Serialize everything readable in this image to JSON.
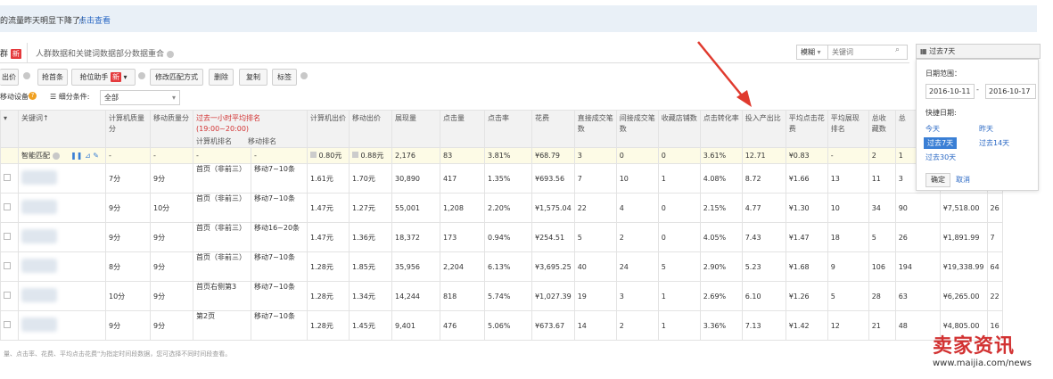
{
  "notice": {
    "text": "的流量昨天明显下降了！",
    "link": "点击查看"
  },
  "tabs": {
    "first_label": "群",
    "new_badge": "新",
    "second_label": "人群数据和关键词数据部分数据重合"
  },
  "search": {
    "mode": "模糊",
    "placeholder": "关键词"
  },
  "date_button": {
    "label": "过去7天"
  },
  "toolbar": {
    "buttons": [
      "出价",
      "抢首条",
      "抢位助手",
      "修改匹配方式",
      "删除",
      "复制",
      "标签"
    ],
    "new_badge": "新",
    "device": "移动设备",
    "filter_label": "细分条件:",
    "filter_value": "全部"
  },
  "table": {
    "headers": [
      "",
      "关键词↑",
      "计算机质量分",
      "移动质量分",
      "过去一小时平均排名(19:00~20:00)",
      "计算机出价",
      "移动出价",
      "展现量",
      "点击量",
      "点击率",
      "花费",
      "直接成交笔数",
      "间接成交笔数",
      "收藏店铺数",
      "点击转化率",
      "投入产出比",
      "平均点击花费",
      "平均展现排名",
      "总收藏数",
      "总",
      ""
    ],
    "subheaders": [
      "计算机排名",
      "移动排名"
    ],
    "summary": {
      "keyword": "智能匹配",
      "cells": [
        "-",
        "-",
        "-",
        "-",
        "0.80元",
        "0.88元",
        "2,176",
        "83",
        "3.81%",
        "¥68.79",
        "3",
        "0",
        "0",
        "3.61%",
        "12.71",
        "¥0.83",
        "-",
        "2",
        "1",
        "",
        ""
      ]
    },
    "rows": [
      {
        "pc_q": "7分",
        "m_q": "9分",
        "pc_rank": "首页（非前三）",
        "m_rank": "移动7~10条",
        "pc_bid": "1.61元",
        "m_bid": "1.70元",
        "impr": "30,890",
        "clicks": "417",
        "ctr": "1.35%",
        "cost": "¥693.56",
        "direct": "7",
        "indirect": "10",
        "fav_shop": "1",
        "cvr": "4.08%",
        "roi": "8.72",
        "cpc": "¥1.66",
        "avg_rank": "13",
        "fav_total": "11",
        "c1": "3",
        "c2": "",
        "c3": ""
      },
      {
        "pc_q": "9分",
        "m_q": "10分",
        "pc_rank": "首页（非前三）",
        "m_rank": "移动7~10条",
        "pc_bid": "1.47元",
        "m_bid": "1.27元",
        "impr": "55,001",
        "clicks": "1,208",
        "ctr": "2.20%",
        "cost": "¥1,575.04",
        "direct": "22",
        "indirect": "4",
        "fav_shop": "0",
        "cvr": "2.15%",
        "roi": "4.77",
        "cpc": "¥1.30",
        "avg_rank": "10",
        "fav_total": "34",
        "c1": "90",
        "c2": "¥7,518.00",
        "c3": "26"
      },
      {
        "pc_q": "9分",
        "m_q": "9分",
        "pc_rank": "首页（非前三）",
        "m_rank": "移动16~20条",
        "pc_bid": "1.47元",
        "m_bid": "1.36元",
        "impr": "18,372",
        "clicks": "173",
        "ctr": "0.94%",
        "cost": "¥254.51",
        "direct": "5",
        "indirect": "2",
        "fav_shop": "0",
        "cvr": "4.05%",
        "roi": "7.43",
        "cpc": "¥1.47",
        "avg_rank": "18",
        "fav_total": "5",
        "c1": "26",
        "c2": "¥1,891.99",
        "c3": "7"
      },
      {
        "pc_q": "8分",
        "m_q": "9分",
        "pc_rank": "首页（非前三）",
        "m_rank": "移动7~10条",
        "pc_bid": "1.28元",
        "m_bid": "1.85元",
        "impr": "35,956",
        "clicks": "2,204",
        "ctr": "6.13%",
        "cost": "¥3,695.25",
        "direct": "40",
        "indirect": "24",
        "fav_shop": "5",
        "cvr": "2.90%",
        "roi": "5.23",
        "cpc": "¥1.68",
        "avg_rank": "9",
        "fav_total": "106",
        "c1": "194",
        "c2": "¥19,338.99",
        "c3": "64"
      },
      {
        "pc_q": "10分",
        "m_q": "9分",
        "pc_rank": "首页右侧第3",
        "m_rank": "移动7~10条",
        "pc_bid": "1.28元",
        "m_bid": "1.34元",
        "impr": "14,244",
        "clicks": "818",
        "ctr": "5.74%",
        "cost": "¥1,027.39",
        "direct": "19",
        "indirect": "3",
        "fav_shop": "1",
        "cvr": "2.69%",
        "roi": "6.10",
        "cpc": "¥1.26",
        "avg_rank": "5",
        "fav_total": "28",
        "c1": "63",
        "c2": "¥6,265.00",
        "c3": "22"
      },
      {
        "pc_q": "9分",
        "m_q": "9分",
        "pc_rank": "第2页",
        "m_rank": "移动7~10条",
        "pc_bid": "1.28元",
        "m_bid": "1.45元",
        "impr": "9,401",
        "clicks": "476",
        "ctr": "5.06%",
        "cost": "¥673.67",
        "direct": "14",
        "indirect": "2",
        "fav_shop": "1",
        "cvr": "3.36%",
        "roi": "7.13",
        "cpc": "¥1.42",
        "avg_rank": "12",
        "fav_total": "21",
        "c1": "48",
        "c2": "¥4,805.00",
        "c3": "16"
      }
    ]
  },
  "datepicker": {
    "range_label": "日期范围：",
    "start": "2016-10-11",
    "sep": "-",
    "end": "2016-10-17",
    "quick_label": "快捷日期:",
    "quick": [
      "今天",
      "昨天",
      "过去7天",
      "过去14天",
      "过去30天"
    ],
    "confirm": "确定",
    "cancel": "取消"
  },
  "footnote": "量、点击率、花费、平均点击花费\"为指定时间段数据，您可选择不同时间段查看。",
  "watermark": {
    "title": "卖家资讯",
    "url": "www.maijia.com/news"
  },
  "colors": {
    "accent": "#3a7fd5",
    "red": "#d23232",
    "notice_bg": "#e9f0f7"
  }
}
